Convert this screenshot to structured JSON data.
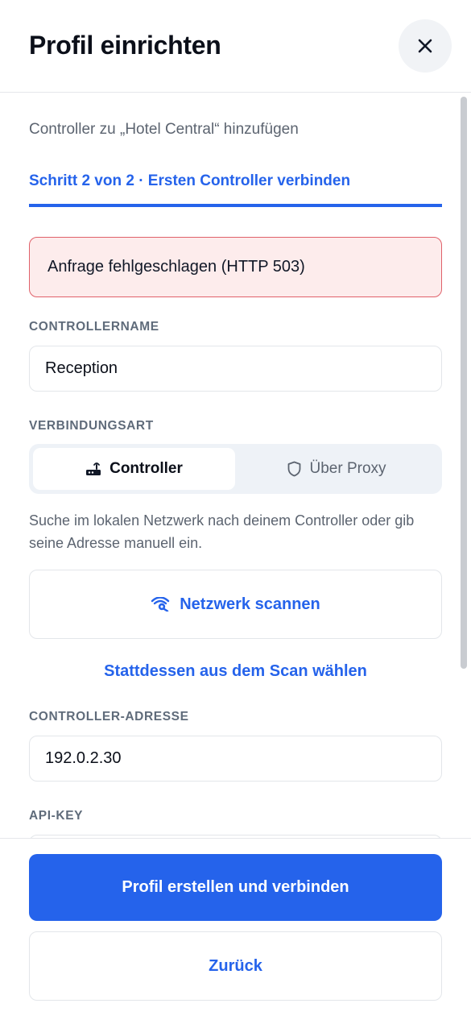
{
  "header": {
    "title": "Profil einrichten",
    "close_icon": "close-icon"
  },
  "intro": {
    "subtitle": "Controller zu „Hotel Central“ hinzufügen",
    "step_tab": "Schritt 2 von 2 · Ersten Controller verbinden"
  },
  "error": {
    "message": "Anfrage fehlgeschlagen (HTTP 503)"
  },
  "controller_name": {
    "label": "CONTROLLERNAME",
    "value": "Reception"
  },
  "connection_type": {
    "label": "VERBINDUNGSART",
    "options": [
      {
        "label": "Controller",
        "icon": "router-icon",
        "selected": true
      },
      {
        "label": "Über Proxy",
        "icon": "shield-icon",
        "selected": false
      }
    ]
  },
  "help_text": "Suche im lokalen Netzwerk nach deinem Controller oder gib seine Adresse manuell ein.",
  "scan": {
    "button_label": "Netzwerk scannen",
    "button_icon": "radar-icon",
    "link_label": "Stattdessen aus dem Scan wählen"
  },
  "controller_address": {
    "label": "CONTROLLER-ADRESSE",
    "value": "192.0.2.30"
  },
  "api_key": {
    "label": "API-KEY",
    "value": ""
  },
  "footer": {
    "primary_label": "Profil erstellen und verbinden",
    "secondary_label": "Zurück"
  },
  "colors": {
    "accent": "#2563eb",
    "error_bg": "#fdecec",
    "error_border": "#e0616a"
  }
}
